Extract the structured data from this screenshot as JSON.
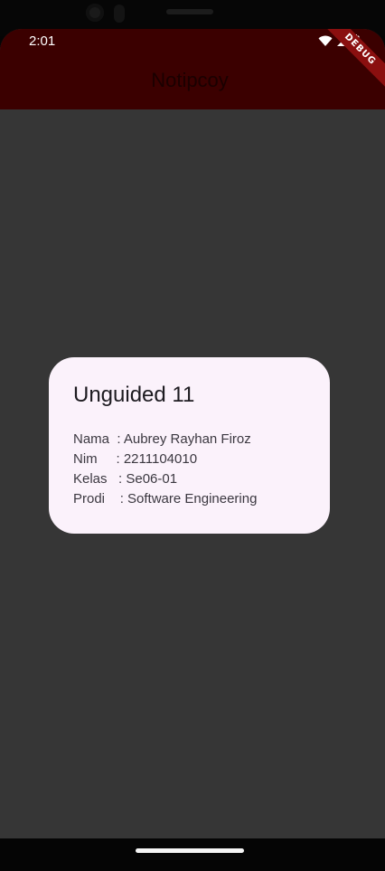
{
  "status_bar": {
    "time": "2:01",
    "icons": [
      "wifi-icon",
      "signal-icon",
      "battery-icon"
    ]
  },
  "app_bar": {
    "title": "Notipcoy",
    "background": "#3b0000"
  },
  "debug_banner": {
    "label": "DEBUG"
  },
  "dialog": {
    "title": "Unguided 11",
    "rows": [
      {
        "label": "Nama  ",
        "value": ": Aubrey Rayhan Firoz"
      },
      {
        "label": "Nim     ",
        "value": ": 2211104010"
      },
      {
        "label": "Kelas   ",
        "value": ": Se06-01"
      },
      {
        "label": "Prodi    ",
        "value": ": Software Engineering"
      }
    ]
  },
  "colors": {
    "scrim": "#363636",
    "dialog_bg": "#fbf2fb"
  }
}
